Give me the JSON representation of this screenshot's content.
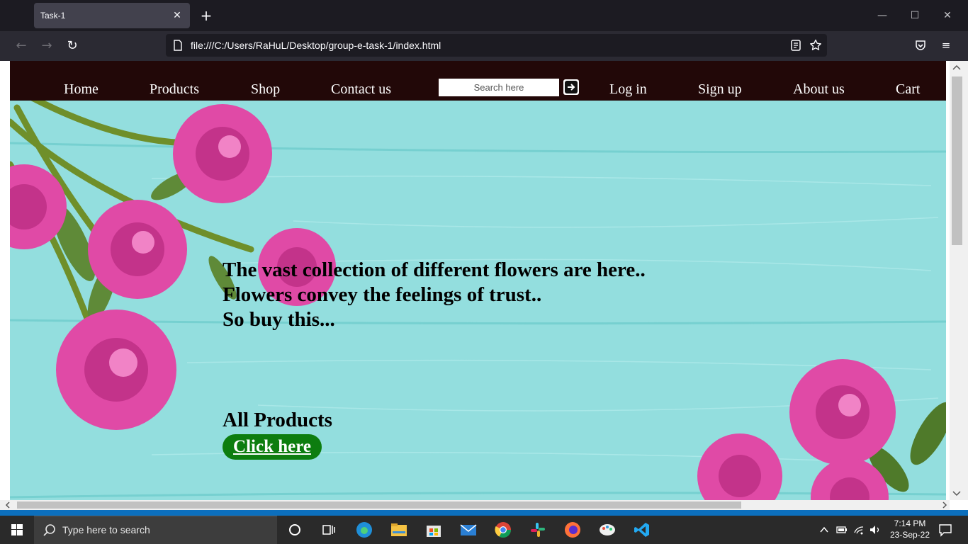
{
  "browser": {
    "tab_title": "Task-1",
    "tab_close": "✕",
    "new_tab": "+",
    "url": "file:///C:/Users/RaHuL/Desktop/group-e-task-1/index.html",
    "back": "←",
    "forward": "→",
    "reload": "↻",
    "minimize": "—",
    "maximize": "☐",
    "close": "✕",
    "menu": "≡"
  },
  "site": {
    "nav": {
      "home": "Home",
      "products": "Products",
      "shop": "Shop",
      "contact": "Contact us",
      "search_placeholder": "Search here",
      "login": "Log in",
      "signup": "Sign up",
      "about": "About us",
      "cart": "Cart"
    },
    "hero": {
      "line1": "The vast collection of different flowers are here..",
      "line2": "Flowers convey the feelings of trust..",
      "line3": "So buy this...",
      "all_products": "All Products",
      "cta": "Click here"
    },
    "colors": {
      "nav_bg": "#220808",
      "cta_bg": "#0d7d0f",
      "hero_bg": "#93dede",
      "rose": "#e04aa6"
    }
  },
  "taskbar": {
    "search_placeholder": "Type here to search",
    "time": "7:14 PM",
    "date": "23-Sep-22"
  }
}
